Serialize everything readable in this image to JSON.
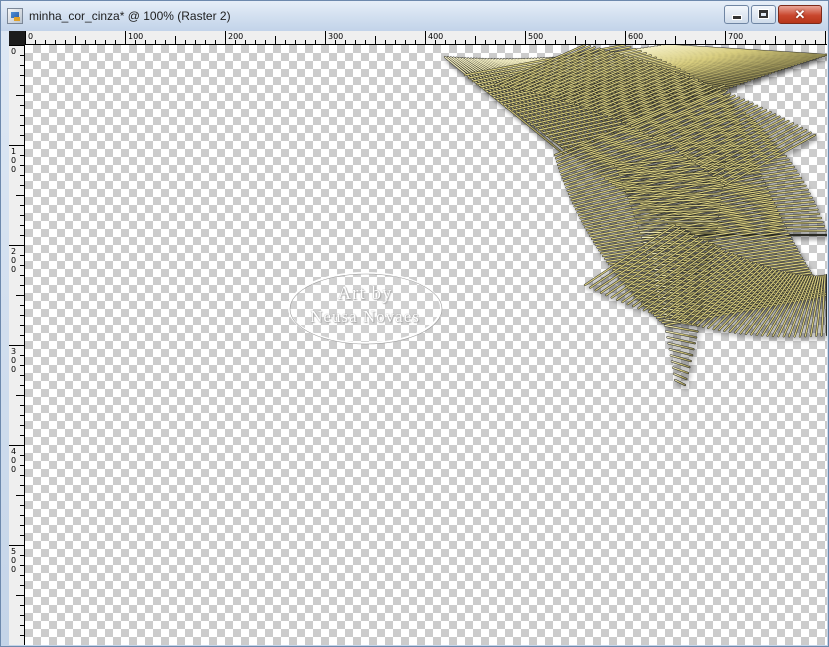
{
  "window": {
    "title": "minha_cor_cinza* @ 100% (Raster 2)",
    "controls": {
      "minimize_icon": "minimize-icon",
      "maximize_icon": "maximize-icon",
      "close_icon": "close-icon",
      "close_glyph": "✕"
    }
  },
  "rulers": {
    "horizontal_labels": [
      "0",
      "100",
      "200",
      "300",
      "400",
      "500",
      "600",
      "700"
    ],
    "vertical_labels": [
      "0",
      "100",
      "200",
      "300",
      "400",
      "500"
    ]
  },
  "canvas": {
    "background": "transparency-checkerboard",
    "layer": "Raster 2"
  },
  "watermark": {
    "line1": "Art by",
    "line2": "Neusa Novaes"
  },
  "colors": {
    "art_gold": "#d8cd7e",
    "art_dark": "#2a2a24",
    "close_red": "#c9472e"
  }
}
